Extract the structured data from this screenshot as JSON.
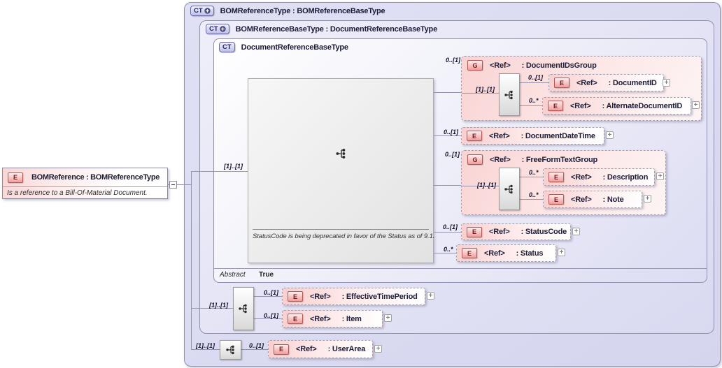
{
  "icons": {
    "expand": "+",
    "collapse": "dash",
    "sequence": "sequence-connector",
    "plus_circle": "circled-plus"
  },
  "root_element": {
    "badge": "E",
    "title": "BOMReference : BOMReferenceType",
    "annotation": "Is a reference to a Bill-Of-Material Document."
  },
  "containers": [
    {
      "badge": "CT",
      "title": "BOMReferenceType : BOMReferenceBaseType"
    },
    {
      "badge": "CT",
      "title": "BOMReferenceBaseType : DocumentReferenceBaseType"
    },
    {
      "badge": "CT",
      "title": "DocumentReferenceBaseType",
      "abstract_label": "Abstract",
      "abstract_value": "True"
    }
  ],
  "content_model": {
    "deprecation_note": "StatusCode is being deprecated in favor of the Status as of 9.1."
  },
  "sequences": [
    {
      "cardinality": "[1]..[1]"
    },
    {
      "cardinality": "[1]..[1]"
    },
    {
      "cardinality": "[1]..[1]"
    },
    {
      "cardinality": "[1]..[1]"
    },
    {
      "cardinality": "[1]..[1]"
    }
  ],
  "elements": [
    {
      "badge": "G",
      "ref": "<Ref>",
      "name": ": DocumentIDsGroup",
      "cardinality": "0..[1]"
    },
    {
      "badge": "E",
      "ref": "<Ref>",
      "name": ": DocumentID",
      "cardinality": "0..[1]"
    },
    {
      "badge": "E",
      "ref": "<Ref>",
      "name": ": AlternateDocumentID",
      "cardinality": "0..*"
    },
    {
      "badge": "E",
      "ref": "<Ref>",
      "name": ": DocumentDateTime",
      "cardinality": "0..[1]"
    },
    {
      "badge": "G",
      "ref": "<Ref>",
      "name": ": FreeFormTextGroup",
      "cardinality": "0..[1]"
    },
    {
      "badge": "E",
      "ref": "<Ref>",
      "name": ": Description",
      "cardinality": "0..*"
    },
    {
      "badge": "E",
      "ref": "<Ref>",
      "name": ": Note",
      "cardinality": "0..*"
    },
    {
      "badge": "E",
      "ref": "<Ref>",
      "name": ": StatusCode",
      "cardinality": "0..[1]"
    },
    {
      "badge": "E",
      "ref": "<Ref>",
      "name": ": Status",
      "cardinality": "0..*"
    },
    {
      "badge": "E",
      "ref": "<Ref>",
      "name": ": EffectiveTimePeriod",
      "cardinality": "0..[1]"
    },
    {
      "badge": "E",
      "ref": "<Ref>",
      "name": ": Item",
      "cardinality": "0..[1]"
    },
    {
      "badge": "E",
      "ref": "<Ref>",
      "name": ": UserArea",
      "cardinality": "0..[1]"
    }
  ]
}
